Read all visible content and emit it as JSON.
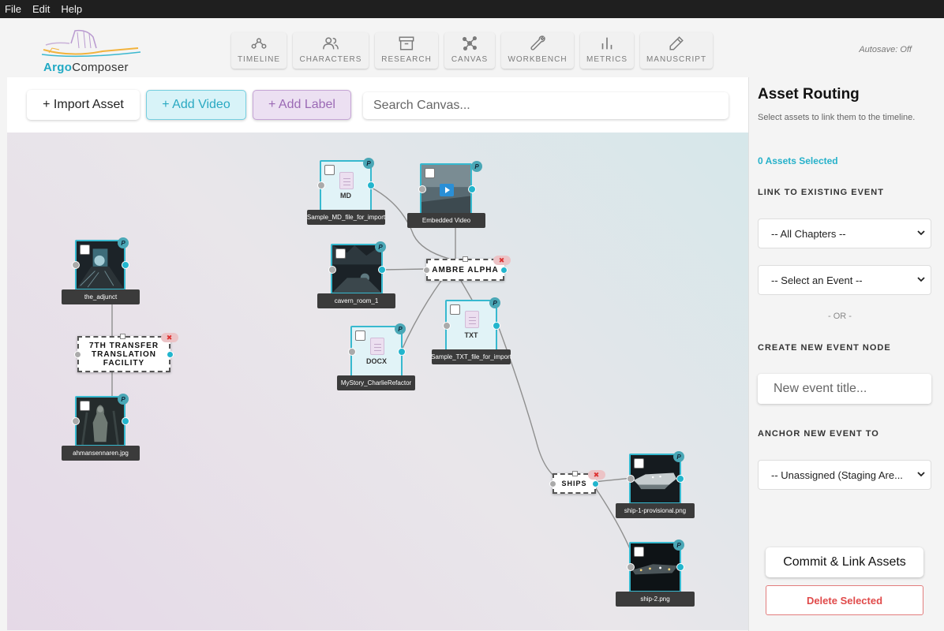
{
  "menu": [
    "File",
    "Edit",
    "Help"
  ],
  "app": {
    "name_part1": "Argo",
    "name_part2": "Composer",
    "autosave": "Autosave: Off"
  },
  "nav_tabs": [
    {
      "label": "TIMELINE",
      "icon": "timeline-icon"
    },
    {
      "label": "CHARACTERS",
      "icon": "users-icon"
    },
    {
      "label": "RESEARCH",
      "icon": "archive-icon"
    },
    {
      "label": "CANVAS",
      "icon": "graph-icon"
    },
    {
      "label": "WORKBENCH",
      "icon": "wrench-icon"
    },
    {
      "label": "METRICS",
      "icon": "bar-chart-icon"
    },
    {
      "label": "MANUSCRIPT",
      "icon": "pen-icon"
    }
  ],
  "toolbar": {
    "import_label": "+ Import Asset",
    "video_label": "+ Add Video",
    "label_label": "+ Add Label",
    "search_placeholder": "Search Canvas..."
  },
  "canvas": {
    "assets": [
      {
        "caption": "the_adjunct",
        "kind": "image"
      },
      {
        "caption": "ahmansennaren.jpg",
        "kind": "image"
      },
      {
        "caption": "Sample_MD_file_for_import",
        "kind": "doc",
        "type": "MD"
      },
      {
        "caption": "Embedded Video",
        "kind": "video"
      },
      {
        "caption": "cavern_room_1",
        "kind": "image"
      },
      {
        "caption": "MyStory_CharlieRefactor",
        "kind": "doc",
        "type": "DOCX"
      },
      {
        "caption": "Sample_TXT_file_for_import",
        "kind": "doc",
        "type": "TXT"
      },
      {
        "caption": "ship-1-provisional.png",
        "kind": "image"
      },
      {
        "caption": "ship-2.png",
        "kind": "image"
      }
    ],
    "events": [
      {
        "title": "7TH TRANSFER TRANSLATION FACILITY"
      },
      {
        "title": "AMBRE ALPHA"
      },
      {
        "title": "SHIPS"
      }
    ],
    "badge_glyph": "P",
    "delete_glyph": "✖"
  },
  "panel": {
    "title": "Asset Routing",
    "subtitle": "Select assets to link them to the timeline.",
    "selected_count": "0 Assets Selected",
    "link_heading": "LINK TO EXISTING EVENT",
    "chapter_select": "-- All Chapters --",
    "event_select": "-- Select an Event --",
    "or_text": "- OR -",
    "create_heading": "CREATE NEW EVENT NODE",
    "new_event_placeholder": "New event title...",
    "anchor_heading": "ANCHOR NEW EVENT TO",
    "anchor_select": "-- Unassigned (Staging Are...",
    "commit_label": "Commit & Link Assets",
    "delete_label": "Delete Selected"
  },
  "colors": {
    "accent": "#22b5cd",
    "danger": "#e04a4a",
    "label": "#9b6ab5",
    "menubar": "#1f1f1f"
  }
}
